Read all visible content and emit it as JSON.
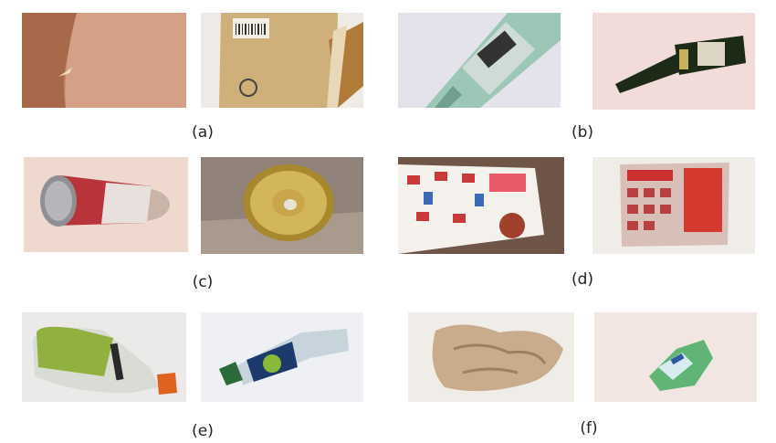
{
  "figure": {
    "panels": [
      {
        "label": "(a)",
        "images": [
          "cardboard",
          "cardboard-box"
        ]
      },
      {
        "label": "(b)",
        "images": [
          "glass-bottle",
          "glass-bottle"
        ]
      },
      {
        "label": "(c)",
        "images": [
          "metal-can",
          "metal-lid"
        ]
      },
      {
        "label": "(d)",
        "images": [
          "paper-flyer",
          "paper-flyer"
        ]
      },
      {
        "label": "(e)",
        "images": [
          "plastic-bottle",
          "plastic-bottle"
        ]
      },
      {
        "label": "(f)",
        "images": [
          "paper-trash",
          "plastic-trash"
        ]
      }
    ]
  }
}
